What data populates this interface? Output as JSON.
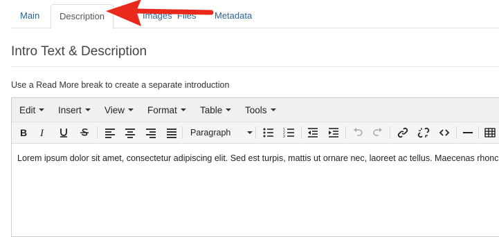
{
  "tabs": [
    {
      "label": "Main"
    },
    {
      "label": "Description"
    },
    {
      "label": "Images"
    },
    {
      "label": "Files"
    },
    {
      "label": "Metadata"
    }
  ],
  "section_title": "Intro Text & Description",
  "hint": "Use a Read More break to create a separate introduction",
  "menubar": [
    "Edit",
    "Insert",
    "View",
    "Format",
    "Table",
    "Tools"
  ],
  "format_select": "Paragraph",
  "content_text": "Lorem ipsum dolor sit amet, consectetur adipiscing elit. Sed est turpis, mattis ut ornare nec, laoreet ac tellus. Maecenas rhoncus e",
  "colors": {
    "link": "#2a6496",
    "arrow": "#e8291c"
  }
}
